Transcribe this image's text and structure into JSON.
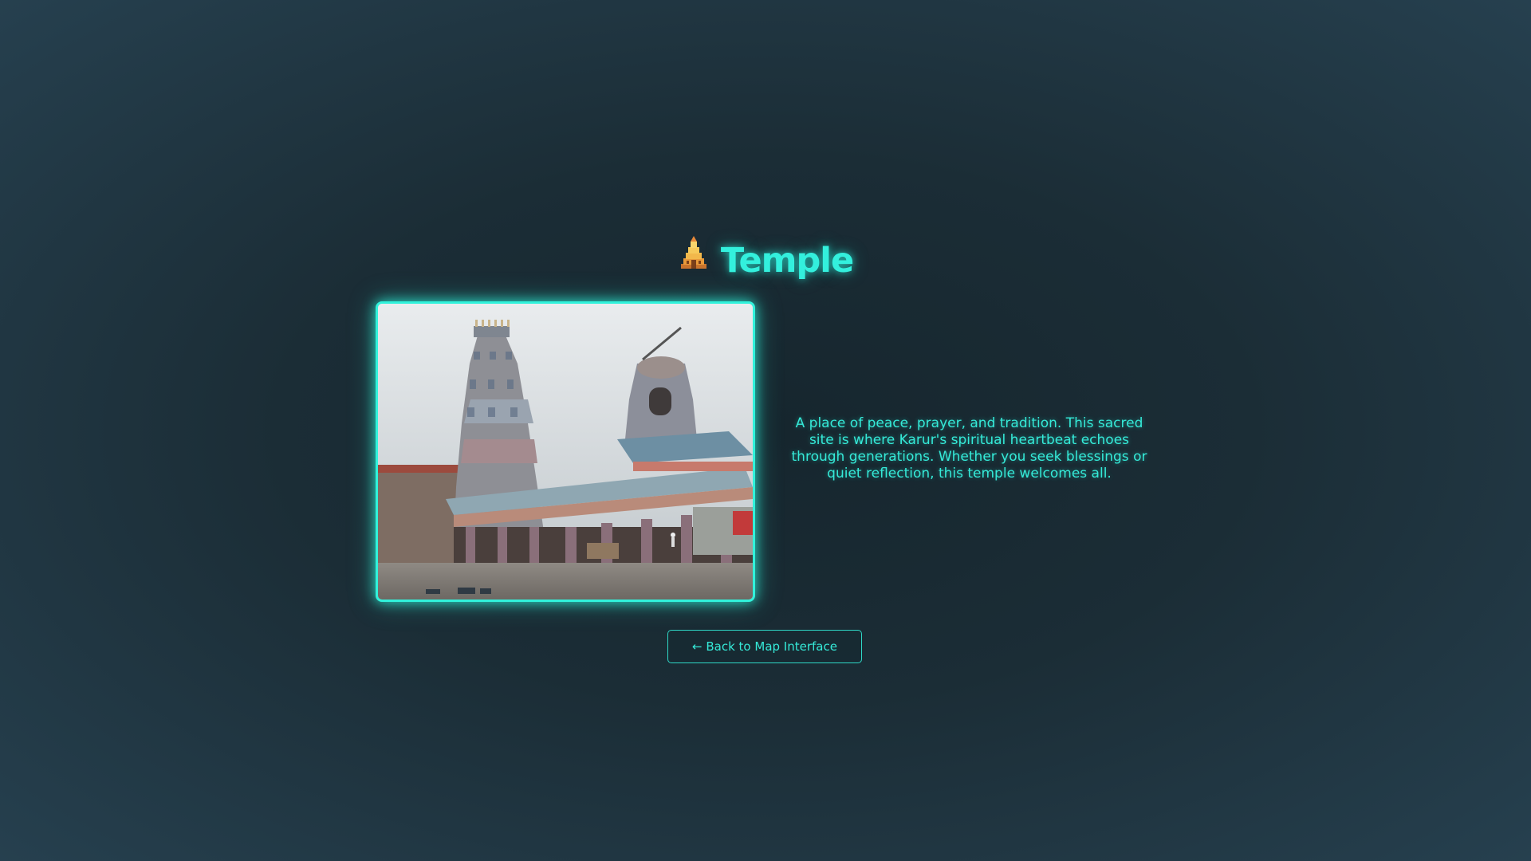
{
  "page": {
    "title": "Temple",
    "title_icon": "temple-icon",
    "description": "A place of peace, prayer, and tradition. This sacred site is where Karur's spiritual heartbeat echoes through generations. Whether you seek blessings or quiet reflection, this temple welcomes all.",
    "back_button_label": "← Back to Map Interface",
    "photo_alt": "Temple photo"
  },
  "colors": {
    "accent": "#31f2db",
    "background_center": "#16262e",
    "background_edge": "#26404f"
  }
}
